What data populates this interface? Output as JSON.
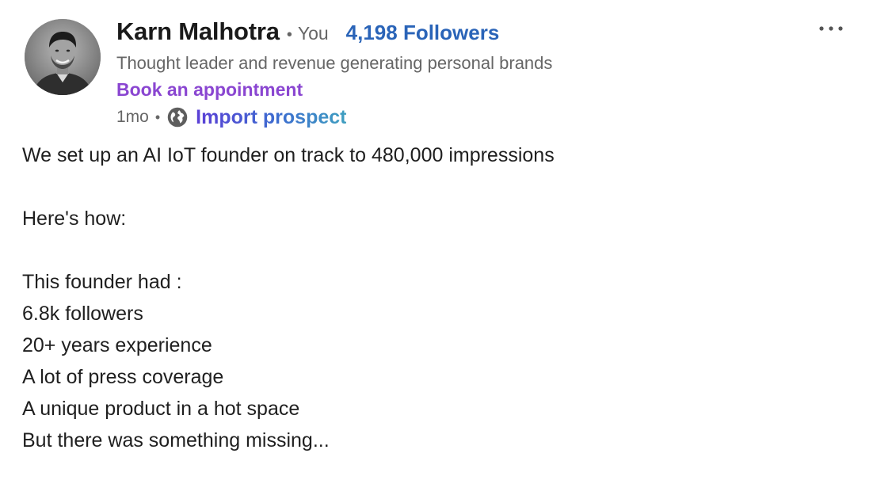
{
  "author": {
    "name": "Karn Malhotra",
    "separator": "•",
    "you_label": "You",
    "followers": "4,198 Followers",
    "headline": "Thought leader and revenue generating personal brands",
    "appointment_link": "Book an appointment"
  },
  "meta": {
    "time_ago": "1mo",
    "separator": "•",
    "visibility_icon": "globe-icon",
    "import_link": "Import prospect"
  },
  "menu": {
    "icon": "more-horizontal-icon"
  },
  "post": {
    "lines": [
      "We set up an AI IoT founder on track to 480,000 impressions",
      "",
      "Here's how:",
      "",
      "This founder had :",
      "6.8k followers",
      "20+ years experience",
      "A lot of press coverage",
      "A unique product in a hot space",
      "But there was something missing..."
    ]
  },
  "colors": {
    "followers_link": "#2a64b8",
    "appointment_link": "#8a46d1",
    "import_gradient_start": "#5b3fd6",
    "import_gradient_end": "#3f9fc0",
    "secondary_text": "#666666",
    "body_text": "#1f1f1f"
  }
}
